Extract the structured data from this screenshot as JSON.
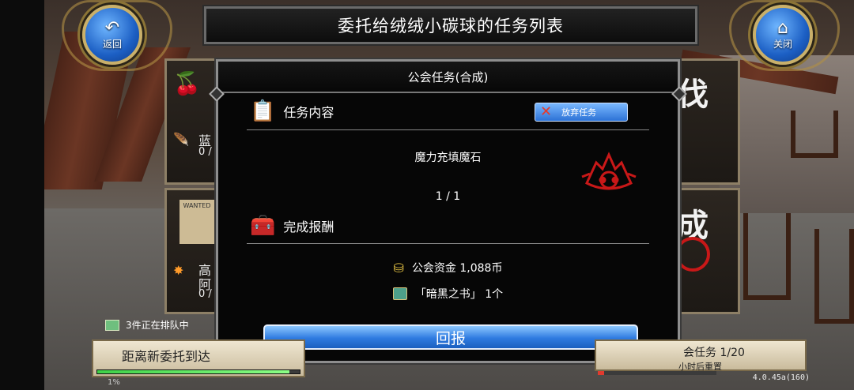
{
  "header": {
    "title": "委托给绒绒小碳球的任务列表",
    "back_label": "返回",
    "close_label": "关闭"
  },
  "background": {
    "left_card_1_text": "蓝",
    "left_card_1_sub": "0 /",
    "left_card_2_stamp": "WANTED",
    "left_card_2_text_a": "高",
    "left_card_2_text_b": "阿",
    "left_card_2_sub": "0 /",
    "right_glyph_1": "伐",
    "right_glyph_2": "成"
  },
  "modal": {
    "title": "公会任务(合成)",
    "section_content": "任务内容",
    "abandon_label": "放弃任务",
    "task_name": "魔力充填魔石",
    "progress": "1 / 1",
    "section_reward": "完成报酬",
    "rewards": [
      {
        "icon": "coin-icon",
        "label": "公会资金 1,088币"
      },
      {
        "icon": "book-icon",
        "label": "「暗黑之书」 1个"
      }
    ],
    "report_label": "回报"
  },
  "hud": {
    "queue_text": "3件正在排队中",
    "next_request_text": "距离新委托到达",
    "green_bar_fill": 0.95,
    "percent_text": "1%",
    "guild_task_text": "会任务 1/20",
    "reset_text": "小时后重置",
    "red_bar_fill": 0.05,
    "version": "4.0.45a(160)"
  },
  "colors": {
    "accent_blue": "#2f7be0",
    "seal_red": "#c81818",
    "frame_gold": "#c9b06a"
  }
}
